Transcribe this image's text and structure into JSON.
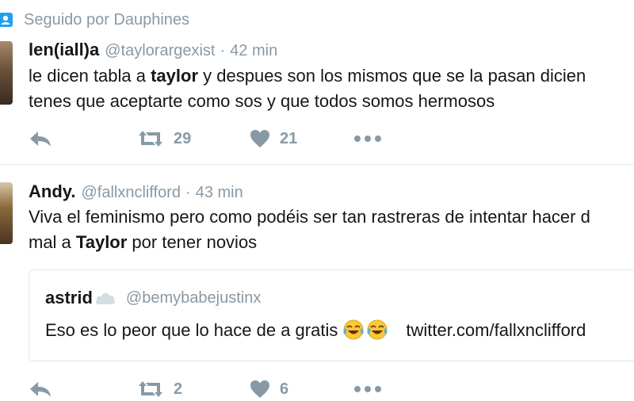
{
  "context": {
    "icon": "person-follow-icon",
    "text": "Seguido por Dauphines"
  },
  "tweets": [
    {
      "name": "len(iall)a",
      "handle": "@taylorargexist",
      "separator": "·",
      "time": "42 min",
      "line1_a": "le dicen tabla a ",
      "line1_b": "taylor",
      "line1_c": " y despues son los mismos que se la pasan dicien",
      "line2": "tenes que aceptarte como sos y que todos somos hermosos",
      "retweets": "29",
      "likes": "21"
    },
    {
      "name": "Andy.",
      "handle": "@fallxnclifford",
      "separator": "·",
      "time": "43 min",
      "line1": "Viva el feminismo pero como podéis ser tan rastreras de intentar hacer d",
      "line2_a": "mal a ",
      "line2_b": "Taylor",
      "line2_c": " por tener novios",
      "quote": {
        "name": "astrid",
        "handle": "@bemybabejustinx",
        "text": "Eso es lo peor que lo hace de a gratis",
        "emoji": "face-with-tears-of-joy",
        "link": "twitter.com/fallxnclifford"
      },
      "retweets": "2",
      "likes": "6"
    }
  ],
  "colors": {
    "muted": "#8899a6",
    "text": "#14171a",
    "divider": "#e6ecf0"
  }
}
